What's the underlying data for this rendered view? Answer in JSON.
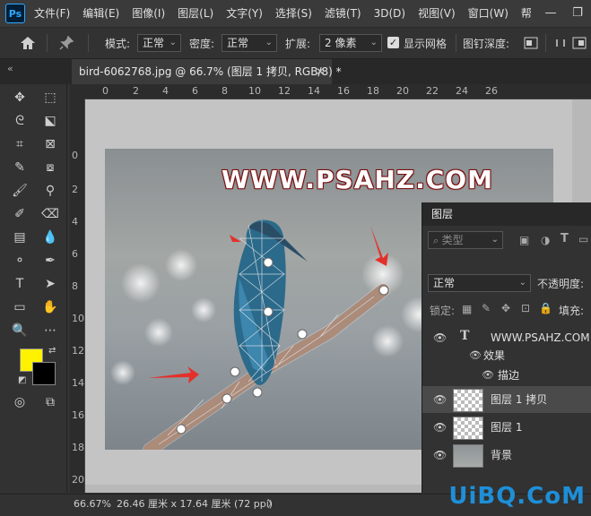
{
  "menubar": {
    "logo": "Ps",
    "items": [
      "文件(F)",
      "编辑(E)",
      "图像(I)",
      "图层(L)",
      "文字(Y)",
      "选择(S)",
      "滤镜(T)",
      "3D(D)",
      "视图(V)",
      "窗口(W)",
      "帮"
    ],
    "minimize": "—",
    "restore": "❐"
  },
  "options": {
    "mode_label": "模式:",
    "mode_value": "正常",
    "density_label": "密度:",
    "density_value": "正常",
    "expand_label": "扩展:",
    "expand_value": "2 像素",
    "show_mesh_label": "显示网格",
    "show_mesh_checked": true,
    "pin_depth_label": "图钉深度:"
  },
  "document": {
    "tab_title": "bird-6062768.jpg @ 66.7% (图层 1 拷贝, RGB/8) *",
    "close_glyph": "✕",
    "watermark": "WWW.PSAHZ.COM"
  },
  "ruler": {
    "h_ticks": [
      "0",
      "2",
      "4",
      "6",
      "8",
      "10",
      "12",
      "14",
      "16",
      "18",
      "20",
      "22",
      "24",
      "26"
    ],
    "v_ticks": [
      "0",
      "2",
      "4",
      "6",
      "8",
      "10",
      "12",
      "14",
      "16",
      "18",
      "20"
    ]
  },
  "colors": {
    "foreground": "#fff200",
    "background": "#000000",
    "accent": "#31a8ff"
  },
  "layers_panel": {
    "tab_label": "图层",
    "filter_placeholder": "类型",
    "blend_mode": "正常",
    "opacity_label": "不透明度:",
    "lock_label": "锁定:",
    "fill_label": "填充:",
    "layers": [
      {
        "name": "WWW.PSAHZ.COM",
        "kind": "text",
        "selected": false
      },
      {
        "name": "效果",
        "kind": "effect-group",
        "selected": false
      },
      {
        "name": "描边",
        "kind": "effect",
        "selected": false
      },
      {
        "name": "图层 1 拷贝",
        "kind": "pixel",
        "selected": true
      },
      {
        "name": "图层 1",
        "kind": "pixel",
        "selected": false
      },
      {
        "name": "背景",
        "kind": "pixel",
        "selected": false
      }
    ]
  },
  "statusbar": {
    "zoom": "66.67%",
    "doc_size": "26.46 厘米 x 17.64 厘米 (72 ppi)",
    "arrow": "〉"
  },
  "brand": "UiBQ.CoM"
}
